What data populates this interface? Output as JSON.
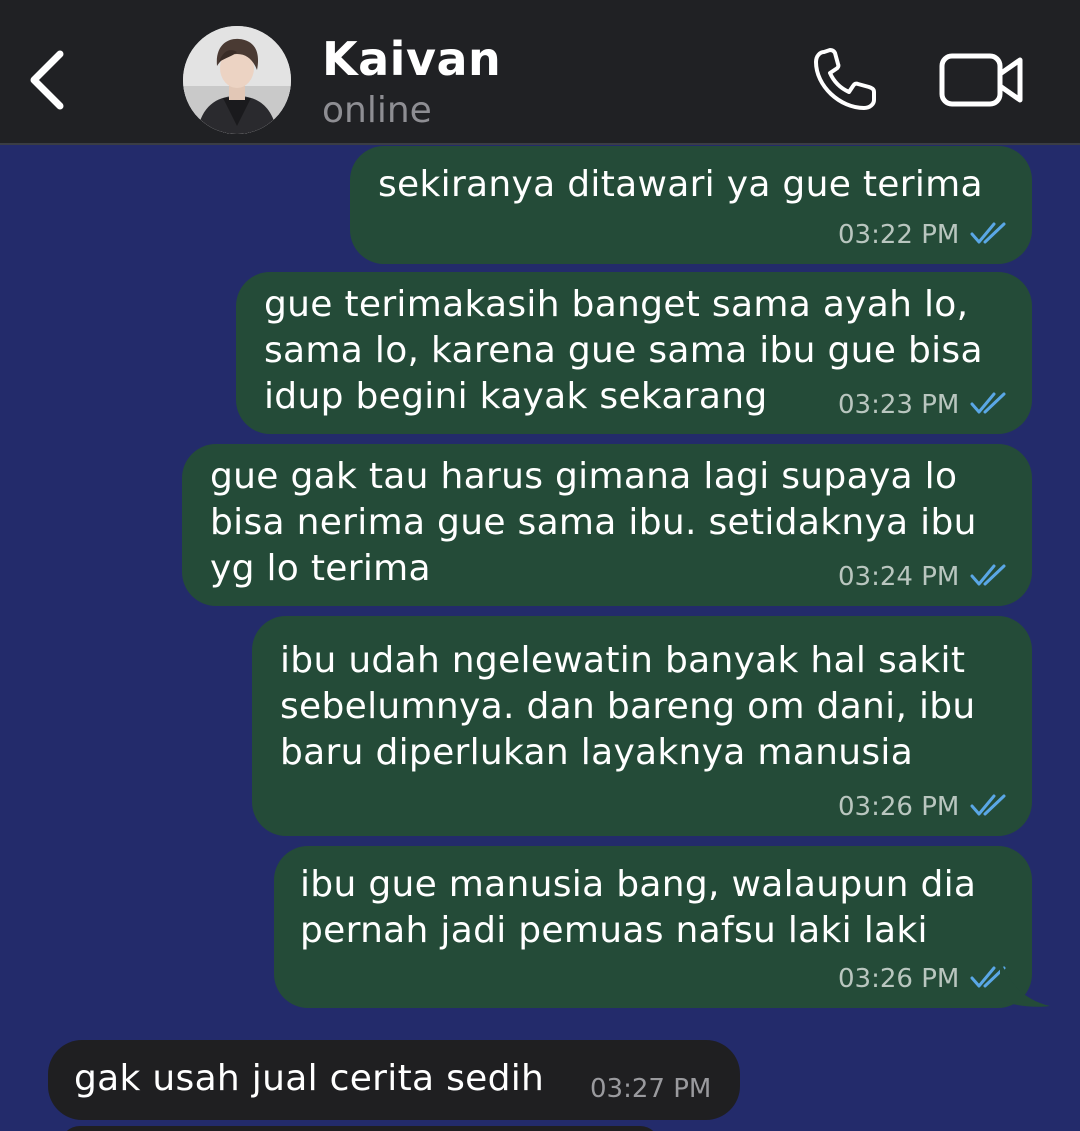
{
  "header": {
    "contact_name": "Kaivan",
    "status": "online"
  },
  "icons": {
    "back": "chevron-left-icon",
    "call": "phone-icon",
    "video": "video-camera-icon",
    "read": "double-check-icon"
  },
  "colors": {
    "background": "#232b6b",
    "header": "#202124",
    "outgoing_bubble": "#244b38",
    "incoming_bubble": "#1f1f21",
    "read_ticks": "#5aa7e6"
  },
  "messages": [
    {
      "direction": "out",
      "lines": [
        "sekiranya ditawari ya gue terima"
      ],
      "time": "03:22 PM",
      "read": true
    },
    {
      "direction": "out",
      "lines": [
        "gue terimakasih banget sama ayah lo,",
        "sama lo, karena gue sama ibu gue bisa",
        "idup begini kayak sekarang"
      ],
      "time": "03:23 PM",
      "read": true
    },
    {
      "direction": "out",
      "lines": [
        "gue gak tau harus gimana lagi supaya lo",
        "bisa nerima gue sama ibu. setidaknya ibu",
        "yg lo terima"
      ],
      "time": "03:24 PM",
      "read": true
    },
    {
      "direction": "out",
      "lines": [
        "ibu udah ngelewatin banyak hal sakit",
        "sebelumnya. dan bareng om dani, ibu",
        "baru diperlukan layaknya manusia"
      ],
      "time": "03:26 PM",
      "read": true
    },
    {
      "direction": "out",
      "lines": [
        "ibu gue manusia bang, walaupun dia",
        "pernah jadi pemuas nafsu laki laki"
      ],
      "time": "03:26 PM",
      "read": true
    },
    {
      "direction": "in",
      "lines": [
        "gak usah jual cerita sedih"
      ],
      "time": "03:27 PM",
      "read": false
    }
  ]
}
